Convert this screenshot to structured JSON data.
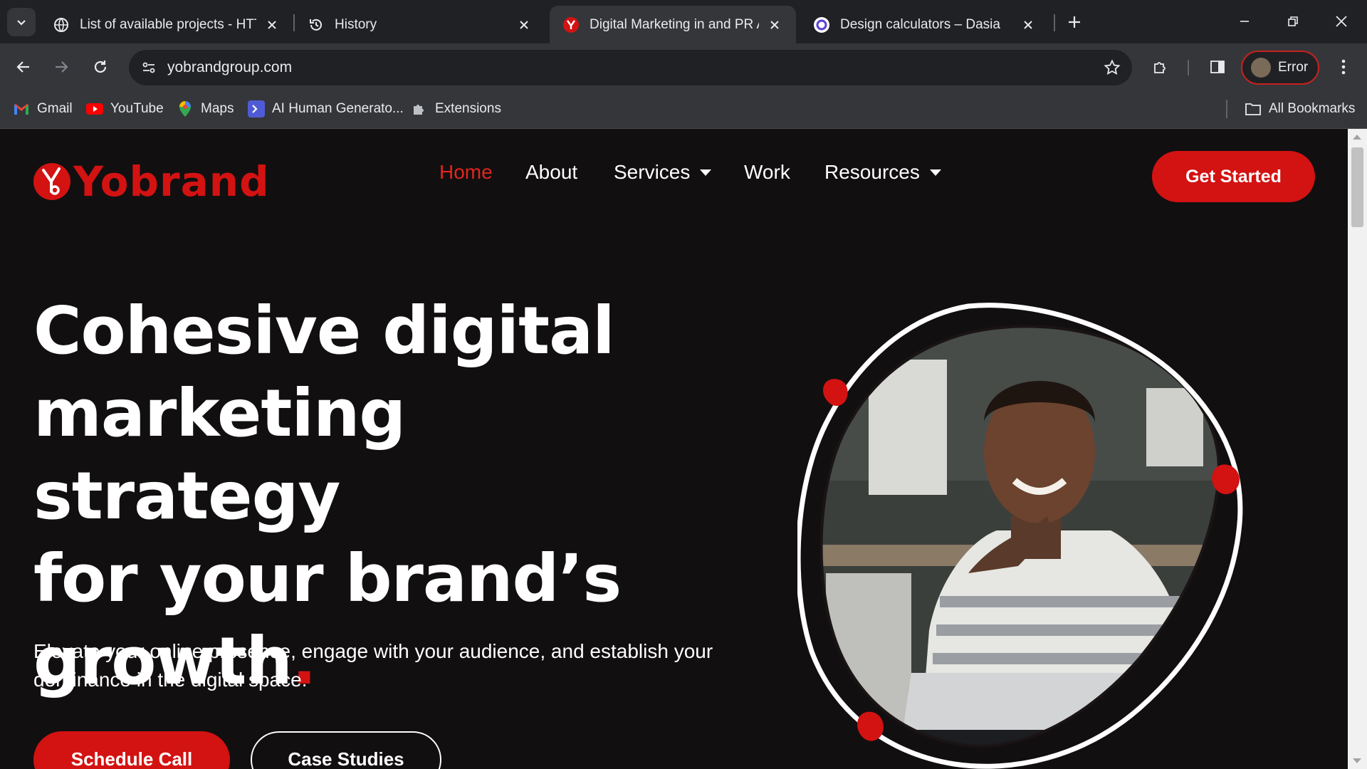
{
  "browser": {
    "tabs": [
      {
        "title": "List of available projects - HTTra",
        "favicon": "globe-icon"
      },
      {
        "title": "History",
        "favicon": "history-icon"
      },
      {
        "title": "Digital Marketing in and PR Age",
        "favicon": "yobrand-favicon"
      },
      {
        "title": "Design calculators – Dasia",
        "favicon": "dasia-favicon"
      }
    ],
    "active_tab_index": 2,
    "url": "yobrandgroup.com",
    "profile_label": "Error",
    "bookmarks": [
      {
        "label": "Gmail",
        "icon": "gmail-icon"
      },
      {
        "label": "YouTube",
        "icon": "youtube-icon"
      },
      {
        "label": "Maps",
        "icon": "maps-icon"
      },
      {
        "label": "AI Human Generato...",
        "icon": "ai-generator-icon"
      },
      {
        "label": "Extensions",
        "icon": "puzzle-icon"
      }
    ],
    "all_bookmarks_label": "All Bookmarks"
  },
  "site": {
    "logo_text": "Yobrand",
    "nav": {
      "home": "Home",
      "about": "About",
      "services": "Services",
      "work": "Work",
      "resources": "Resources"
    },
    "cta_label": "Get Started",
    "hero": {
      "title_line1": "Cohesive digital",
      "title_line2": "marketing strategy",
      "title_line3": "for your brand’s",
      "title_line4": "growth",
      "title_dot": ".",
      "subtitle_line1": "Elevate your online presence, engage with your audience, and establish your",
      "subtitle_line2": "dominance in the digital space.",
      "primary_button": "Schedule Call",
      "secondary_button": "Case Studies"
    }
  },
  "colors": {
    "brand_red": "#d31212",
    "page_background": "#120f10",
    "chrome_dark": "#202124",
    "chrome_toolbar": "#35363a"
  }
}
